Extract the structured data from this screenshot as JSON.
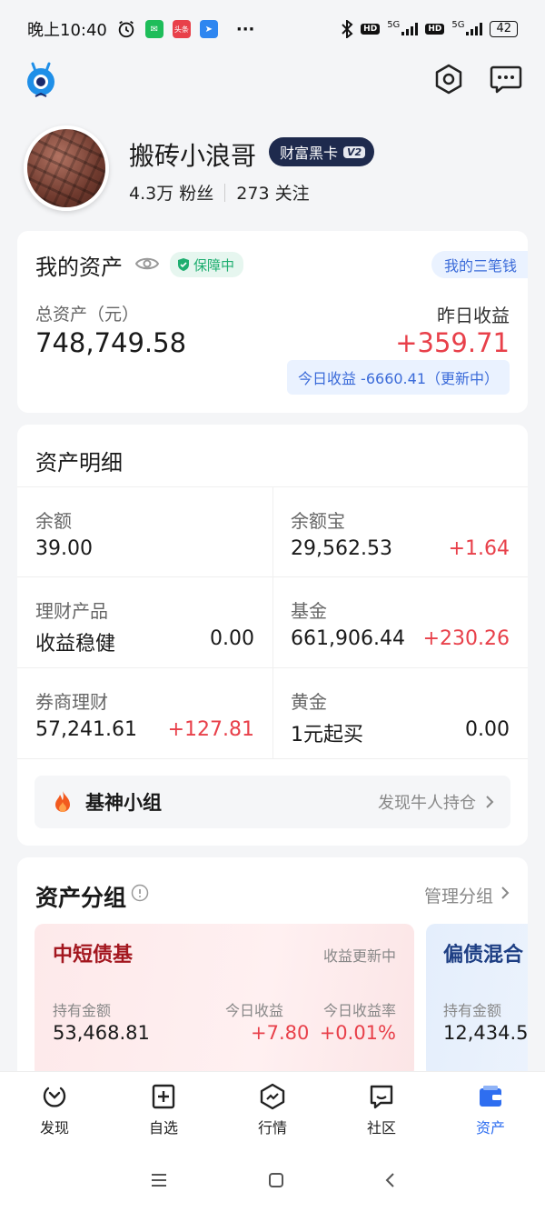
{
  "status_bar": {
    "time": "晚上10:40",
    "app_badge": "头条",
    "net1": "5G",
    "net2": "5G",
    "hd": "HD",
    "battery": "42",
    "more": "···"
  },
  "profile": {
    "nickname": "搬砖小浪哥",
    "badge_label": "财富黑卡",
    "badge_level": "V2",
    "fans": "4.3万 粉丝",
    "following": "273 关注"
  },
  "assets": {
    "title": "我的资产",
    "guard_label": "保障中",
    "three_money": "我的三笔钱",
    "total_label": "总资产（元）",
    "total_value": "748,749.58",
    "yesterday_label": "昨日收益",
    "yesterday_value": "+359.71",
    "today_text": "今日收益 -6660.41（更新中）"
  },
  "detail": {
    "title": "资产明细",
    "cells": [
      {
        "label": "余额",
        "value": "39.00",
        "change": ""
      },
      {
        "label": "余额宝",
        "value": "29,562.53",
        "change": "+1.64"
      },
      {
        "label": "理财产品",
        "value": "收益稳健",
        "change": "0.00"
      },
      {
        "label": "基金",
        "value": "661,906.44",
        "change": "+230.26"
      },
      {
        "label": "券商理财",
        "value": "57,241.61",
        "change": "+127.81"
      },
      {
        "label": "黄金",
        "value": "1元起买",
        "change": "0.00"
      }
    ],
    "group_name": "基神小组",
    "group_link": "发现牛人持仓"
  },
  "groups": {
    "title": "资产分组",
    "manage": "管理分组",
    "cards": [
      {
        "name": "中短债基",
        "status": "收益更新中",
        "hold_label": "持有金额",
        "hold_value": "53,468.81",
        "today_label": "今日收益",
        "today_value": "+7.80",
        "rate_label": "今日收益率",
        "rate_value": "+0.01%"
      },
      {
        "name": "偏债混合",
        "hold_label": "持有金额",
        "hold_value": "12,434.5"
      }
    ]
  },
  "nav": {
    "items": [
      {
        "label": "发现",
        "icon": "discover-icon"
      },
      {
        "label": "自选",
        "icon": "watchlist-icon"
      },
      {
        "label": "行情",
        "icon": "market-icon"
      },
      {
        "label": "社区",
        "icon": "community-icon"
      },
      {
        "label": "资产",
        "icon": "assets-icon"
      }
    ],
    "active": "资产"
  },
  "colors": {
    "accent": "#2e6ef0",
    "up": "#e8404a",
    "guard": "#1fae70",
    "vip": "#1e2a4d"
  }
}
